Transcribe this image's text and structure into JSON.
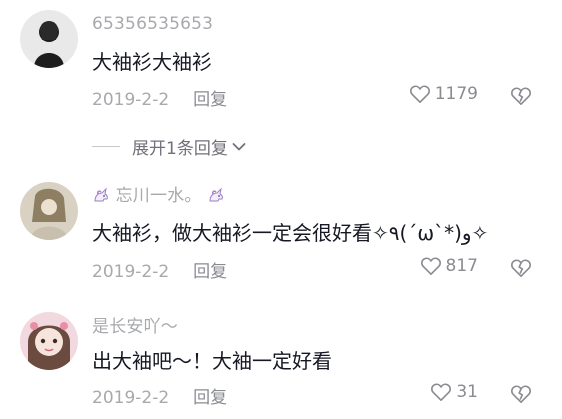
{
  "colors": {
    "text": "#161823",
    "meta": "#a8a9ad",
    "reply": "#8a8b91",
    "background": "#ffffff"
  },
  "comments": [
    {
      "username": "65356535653",
      "text": "大袖衫大袖衫",
      "date": "2019-2-2",
      "reply_label": "回复",
      "likes": "1179"
    },
    {
      "username": "忘川一水。",
      "text": "大袖衫，做大袖衫一定会很好看✧٩(ˊωˋ*)و✧",
      "date": "2019-2-2",
      "reply_label": "回复",
      "likes": "817"
    },
    {
      "username": "是长安吖～",
      "text": "出大袖吧～！大袖一定好看",
      "date": "2019-2-2",
      "reply_label": "回复",
      "likes": "31"
    }
  ],
  "expand_replies": {
    "label": "展开1条回复"
  },
  "icons": {
    "like": "heart-outline-icon",
    "dislike": "broken-heart-icon",
    "expand": "chevron-down-icon",
    "badge": "unicorn-icon"
  }
}
